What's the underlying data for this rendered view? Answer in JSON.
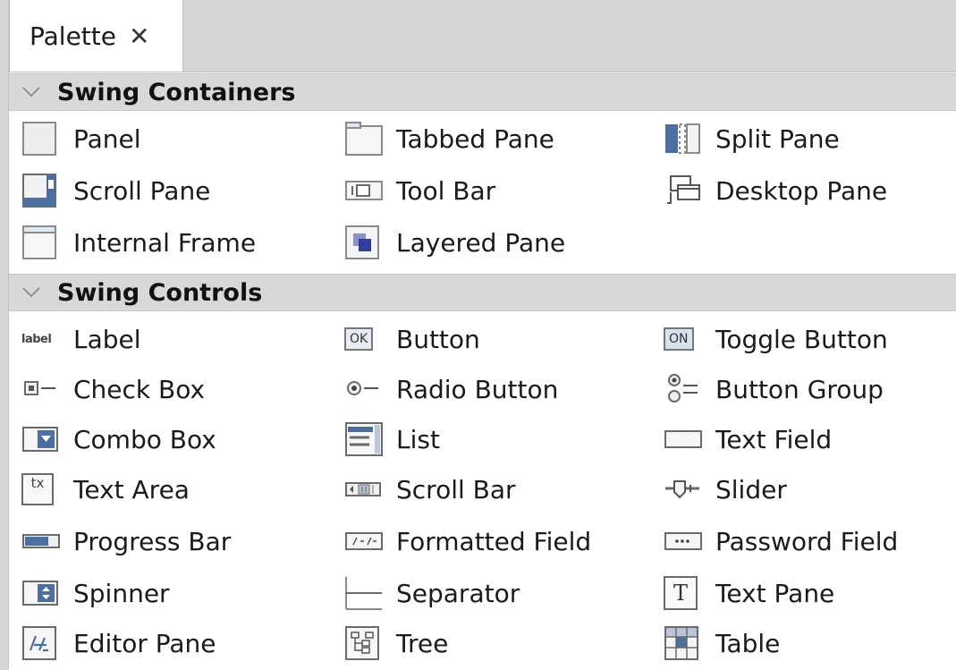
{
  "palette_tab": {
    "label": "Palette",
    "close": "✕"
  },
  "swing_containers": {
    "title": "Swing Containers",
    "items": [
      "Panel",
      "Tabbed Pane",
      "Split Pane",
      "Scroll Pane",
      "Tool Bar",
      "Desktop Pane",
      "Internal Frame",
      "Layered Pane"
    ]
  },
  "swing_controls": {
    "title": "Swing Controls",
    "items": [
      "Label",
      "Button",
      "Toggle Button",
      "Check Box",
      "Radio Button",
      "Button Group",
      "Combo Box",
      "List",
      "Text Field",
      "Text Area",
      "Scroll Bar",
      "Slider",
      "Progress Bar",
      "Formatted Field",
      "Password Field",
      "Spinner",
      "Separator",
      "Text Pane",
      "Editor Pane",
      "Tree",
      "Table"
    ]
  },
  "icon_text": {
    "label": "label",
    "ok": "OK",
    "on": "ON",
    "tx": "tx",
    "t": "T"
  }
}
